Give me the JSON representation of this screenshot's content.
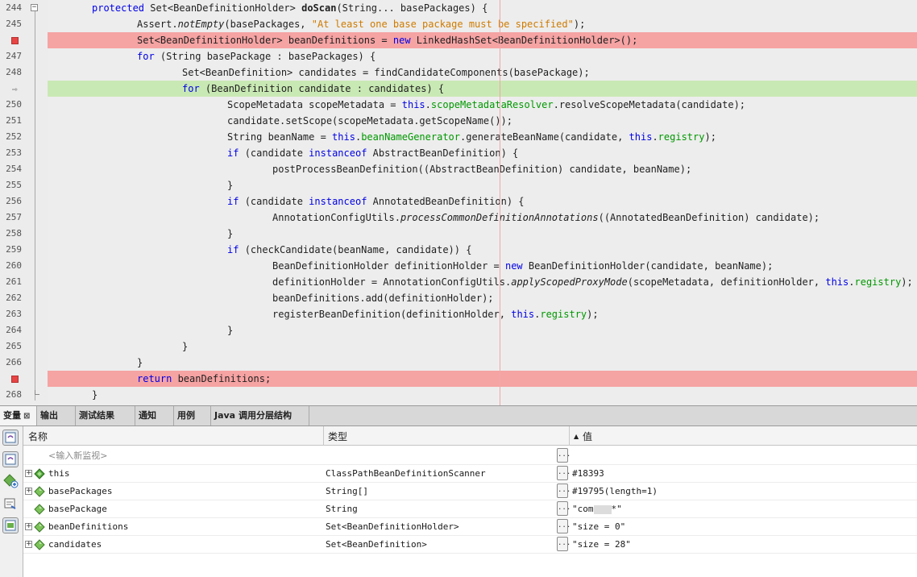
{
  "editor": {
    "lines": [
      {
        "num": "244",
        "marker": "fold",
        "indent": 1,
        "tokens": [
          {
            "t": "protected ",
            "c": "kw"
          },
          {
            "t": "Set<BeanDefinitionHolder> "
          },
          {
            "t": "doScan",
            "c": "bd"
          },
          {
            "t": "(String... basePackages) {"
          }
        ]
      },
      {
        "num": "245",
        "indent": 2,
        "tokens": [
          {
            "t": "Assert."
          },
          {
            "t": "notEmpty",
            "c": "it"
          },
          {
            "t": "(basePackages, "
          },
          {
            "t": "\"At least one base package must be specified\"",
            "c": "st"
          },
          {
            "t": ");"
          }
        ]
      },
      {
        "num": "",
        "marker": "breakpoint",
        "highlight": "red",
        "indent": 2,
        "tokens": [
          {
            "t": "Set<BeanDefinitionHolder> beanDefinitions = "
          },
          {
            "t": "new ",
            "c": "kw"
          },
          {
            "t": "LinkedHashSet<BeanDefinitionHolder>();"
          }
        ]
      },
      {
        "num": "247",
        "indent": 2,
        "tokens": [
          {
            "t": "for ",
            "c": "kw"
          },
          {
            "t": "(String basePackage : basePackages) {"
          }
        ]
      },
      {
        "num": "248",
        "indent": 3,
        "tokens": [
          {
            "t": "Set<BeanDefinition> candidates = findCandidateComponents(basePackage);"
          }
        ]
      },
      {
        "num": "",
        "marker": "current",
        "highlight": "green",
        "indent": 3,
        "tokens": [
          {
            "t": "for ",
            "c": "kw"
          },
          {
            "t": "(BeanDefinition candidate : candidates) {"
          }
        ]
      },
      {
        "num": "250",
        "indent": 4,
        "tokens": [
          {
            "t": "ScopeMetadata scopeMetadata = "
          },
          {
            "t": "this",
            "c": "kw"
          },
          {
            "t": "."
          },
          {
            "t": "scopeMetadataResolver",
            "c": "fd"
          },
          {
            "t": ".resolveScopeMetadata(candidate);"
          }
        ]
      },
      {
        "num": "251",
        "indent": 4,
        "tokens": [
          {
            "t": "candidate.setScope(scopeMetadata.getScopeName());"
          }
        ]
      },
      {
        "num": "252",
        "indent": 4,
        "tokens": [
          {
            "t": "String beanName = "
          },
          {
            "t": "this",
            "c": "kw"
          },
          {
            "t": "."
          },
          {
            "t": "beanNameGenerator",
            "c": "fd"
          },
          {
            "t": ".generateBeanName(candidate, "
          },
          {
            "t": "this",
            "c": "kw"
          },
          {
            "t": "."
          },
          {
            "t": "registry",
            "c": "fd"
          },
          {
            "t": ");"
          }
        ]
      },
      {
        "num": "253",
        "indent": 4,
        "tokens": [
          {
            "t": "if ",
            "c": "kw"
          },
          {
            "t": "(candidate "
          },
          {
            "t": "instanceof ",
            "c": "kw"
          },
          {
            "t": "AbstractBeanDefinition) {"
          }
        ]
      },
      {
        "num": "254",
        "indent": 5,
        "tokens": [
          {
            "t": "postProcessBeanDefinition((AbstractBeanDefinition) candidate, beanName);"
          }
        ]
      },
      {
        "num": "255",
        "indent": 4,
        "tokens": [
          {
            "t": "}"
          }
        ]
      },
      {
        "num": "256",
        "indent": 4,
        "tokens": [
          {
            "t": "if ",
            "c": "kw"
          },
          {
            "t": "(candidate "
          },
          {
            "t": "instanceof ",
            "c": "kw"
          },
          {
            "t": "AnnotatedBeanDefinition) {"
          }
        ]
      },
      {
        "num": "257",
        "indent": 5,
        "tokens": [
          {
            "t": "AnnotationConfigUtils."
          },
          {
            "t": "processCommonDefinitionAnnotations",
            "c": "it"
          },
          {
            "t": "((AnnotatedBeanDefinition) candidate);"
          }
        ]
      },
      {
        "num": "258",
        "indent": 4,
        "tokens": [
          {
            "t": "}"
          }
        ]
      },
      {
        "num": "259",
        "indent": 4,
        "tokens": [
          {
            "t": "if ",
            "c": "kw"
          },
          {
            "t": "(checkCandidate(beanName, candidate)) {"
          }
        ]
      },
      {
        "num": "260",
        "indent": 5,
        "tokens": [
          {
            "t": "BeanDefinitionHolder definitionHolder = "
          },
          {
            "t": "new ",
            "c": "kw"
          },
          {
            "t": "BeanDefinitionHolder(candidate, beanName);"
          }
        ]
      },
      {
        "num": "261",
        "indent": 5,
        "tokens": [
          {
            "t": "definitionHolder = AnnotationConfigUtils."
          },
          {
            "t": "applyScopedProxyMode",
            "c": "it"
          },
          {
            "t": "(scopeMetadata, definitionHolder, "
          },
          {
            "t": "this",
            "c": "kw"
          },
          {
            "t": "."
          },
          {
            "t": "registry",
            "c": "fd"
          },
          {
            "t": ");"
          }
        ]
      },
      {
        "num": "262",
        "indent": 5,
        "tokens": [
          {
            "t": "beanDefinitions.add(definitionHolder);"
          }
        ]
      },
      {
        "num": "263",
        "indent": 5,
        "tokens": [
          {
            "t": "registerBeanDefinition(definitionHolder, "
          },
          {
            "t": "this",
            "c": "kw"
          },
          {
            "t": "."
          },
          {
            "t": "registry",
            "c": "fd"
          },
          {
            "t": ");"
          }
        ]
      },
      {
        "num": "264",
        "indent": 4,
        "tokens": [
          {
            "t": "}"
          }
        ]
      },
      {
        "num": "265",
        "indent": 3,
        "tokens": [
          {
            "t": "}"
          }
        ]
      },
      {
        "num": "266",
        "indent": 2,
        "tokens": [
          {
            "t": "}"
          }
        ]
      },
      {
        "num": "",
        "marker": "breakpoint",
        "highlight": "red",
        "indent": 2,
        "tokens": [
          {
            "t": "return ",
            "c": "kw"
          },
          {
            "t": "beanDefinitions;"
          }
        ]
      },
      {
        "num": "268",
        "marker": "foldend",
        "indent": 1,
        "tokens": [
          {
            "t": "}"
          }
        ]
      }
    ]
  },
  "tabs": [
    {
      "label": "变量",
      "close": "⊠",
      "active": true
    },
    {
      "label": "输出"
    },
    {
      "label": "测试结果"
    },
    {
      "label": "通知"
    },
    {
      "label": "用例"
    },
    {
      "label": "Java 调用分层结构"
    }
  ],
  "variables": {
    "headers": {
      "name": "名称",
      "type": "类型",
      "value": "值",
      "sort_arrow": "▲"
    },
    "watch_placeholder": "<输入新监视>",
    "edit_button": "...",
    "rows": [
      {
        "name": "this",
        "type": "ClassPathBeanDefinitionScanner",
        "value": "#18393",
        "expandable": true
      },
      {
        "name": "basePackages",
        "type": "String[]",
        "value": "#19795(length=1)",
        "expandable": true
      },
      {
        "name": "basePackage",
        "type": "String",
        "value_pre": "\"com",
        "value_post": "*\"",
        "censored": true,
        "expandable": false
      },
      {
        "name": "beanDefinitions",
        "type": "Set<BeanDefinitionHolder>",
        "value": "\"size = 0\"",
        "expandable": true
      },
      {
        "name": "candidates",
        "type": "Set<BeanDefinition>",
        "value": "\"size = 28\"",
        "expandable": true
      }
    ]
  },
  "colors": {
    "keyword": "#0000e6",
    "string": "#ce7b00",
    "field": "#009900",
    "breakpoint_line": "#f6a3a3",
    "current_line": "#c9e9b4"
  }
}
